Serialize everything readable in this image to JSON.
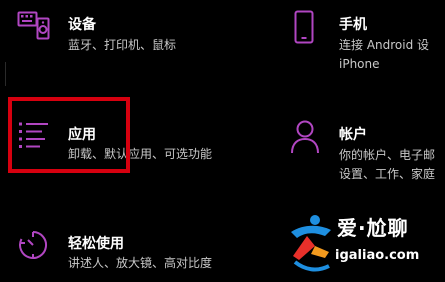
{
  "colors": {
    "background": "#000000",
    "accent": "#b146c2",
    "title": "#ffffff",
    "description": "#c8c8c8",
    "highlight": "#d6000f"
  },
  "tiles": {
    "devices": {
      "icon": "keyboard-speaker-icon",
      "title": "设备",
      "desc": [
        "蓝牙、打印机、鼠标"
      ]
    },
    "phone": {
      "icon": "phone-icon",
      "title": "手机",
      "desc": [
        "连接 Android 设",
        "iPhone"
      ]
    },
    "apps": {
      "icon": "apps-list-icon",
      "title": "应用",
      "desc": [
        "卸载、默认应用、可选功能"
      ]
    },
    "accounts": {
      "icon": "person-icon",
      "title": "帐户",
      "desc": [
        "你的帐户、电子邮",
        "设置、工作、家庭"
      ]
    },
    "ease_of_access": {
      "icon": "ease-of-access-timer-icon",
      "title": "轻松使用",
      "desc": [
        "讲述人、放大镜、高对比度"
      ]
    }
  },
  "watermark": {
    "brand": "爱·尬聊",
    "url": "igaliao.com"
  }
}
